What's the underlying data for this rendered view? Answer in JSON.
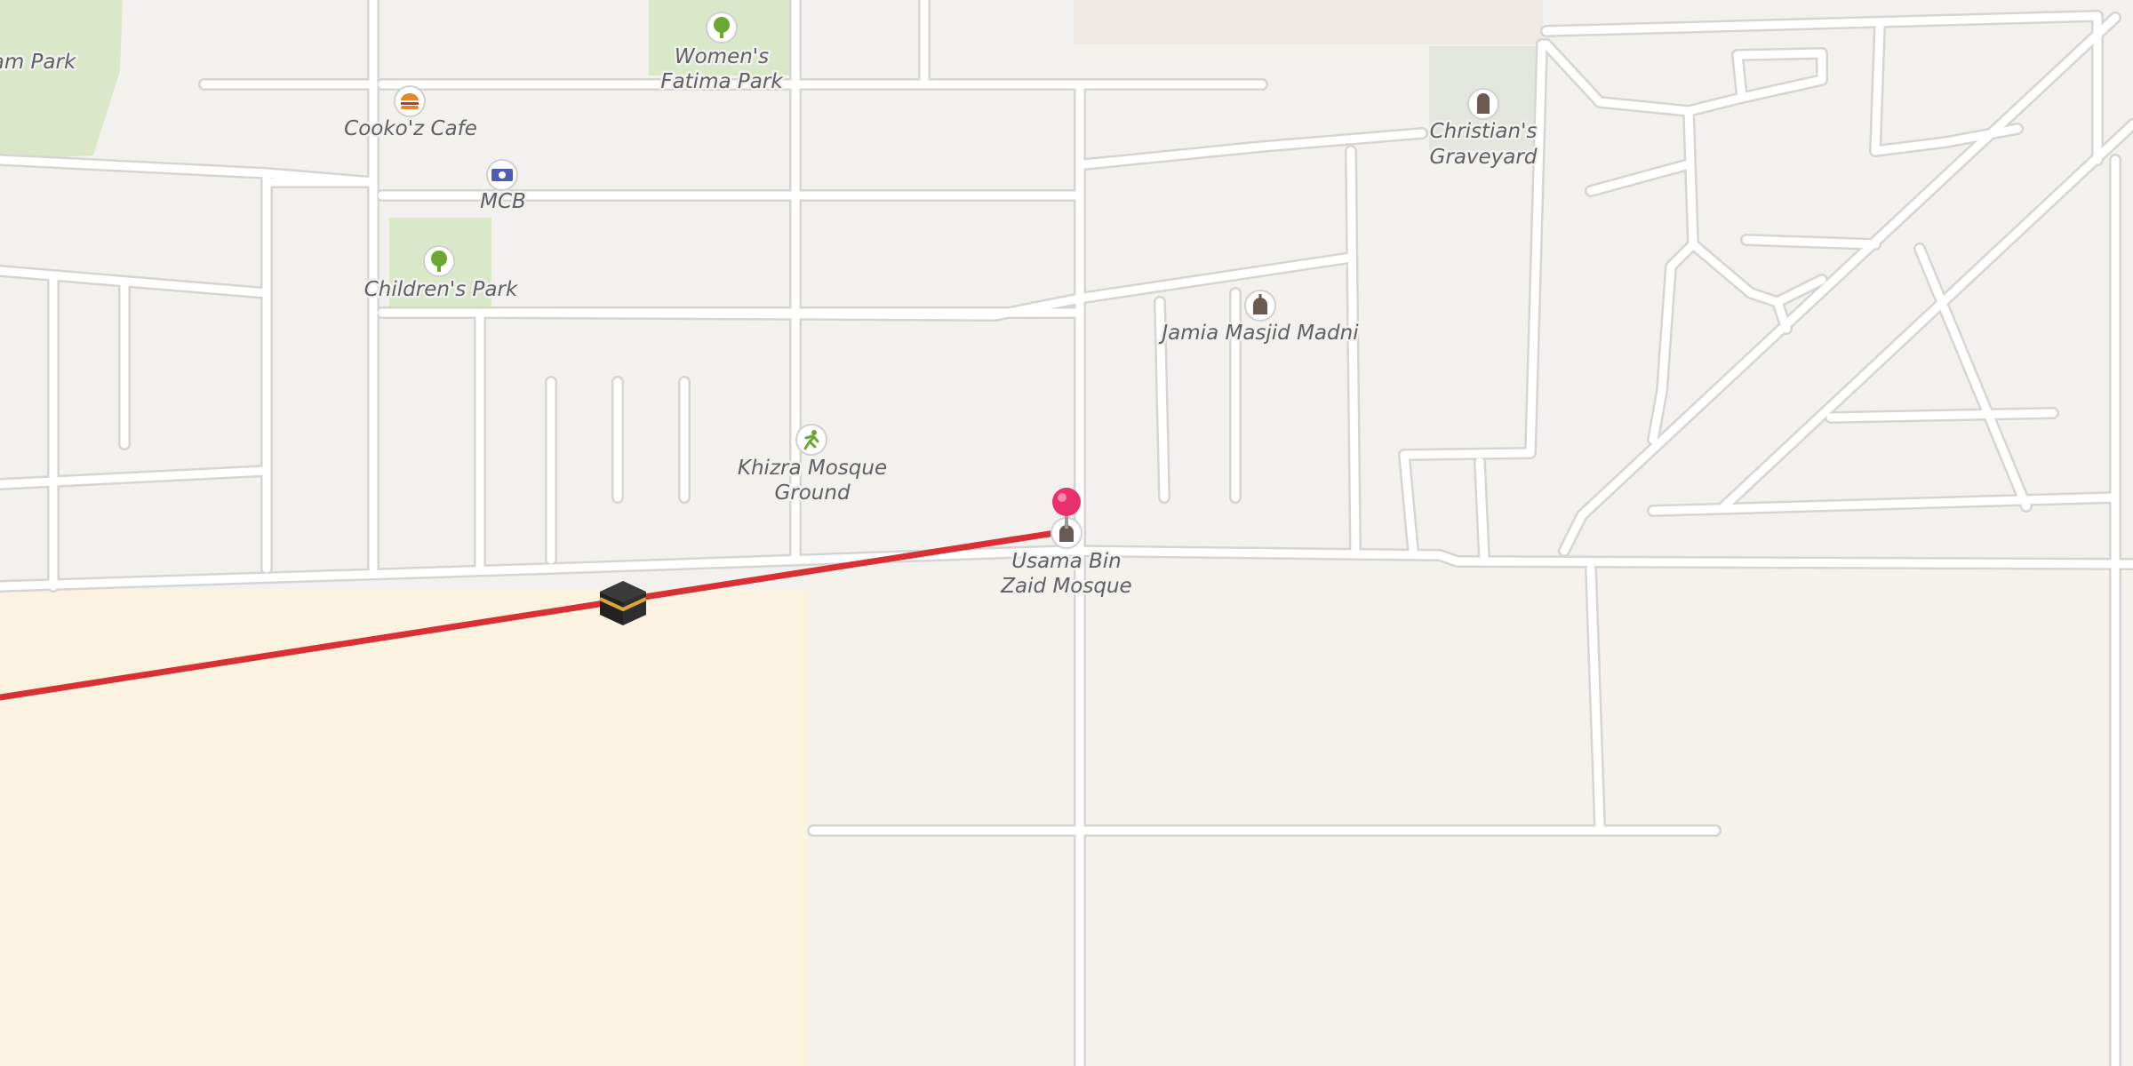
{
  "map": {
    "labels": {
      "park_partial": "am Park",
      "cafe": "Cooko'z Cafe",
      "bank": "MCB",
      "childrens_park": "Children's Park",
      "womens_park_line1": "Women's",
      "womens_park_line2": "Fatima Park",
      "graveyard_line1": "Christian's",
      "graveyard_line2": "Graveyard",
      "jamia_masjid": "Jamia Masjid Madni",
      "ground_line1": "Khizra Mosque",
      "ground_line2": "Ground",
      "usama_line1": "Usama Bin",
      "usama_line2": "Zaid Mosque"
    },
    "icons": {
      "park": "tree-icon",
      "cafe": "burger-icon",
      "bank": "banknote-icon",
      "mosque": "mosque-icon",
      "sports": "running-person-icon",
      "cemetery": "gravestone-icon",
      "pin": "location-pin-icon",
      "qibla": "kaaba-icon"
    },
    "colors": {
      "land": "#f3f1ee",
      "road": "#ffffff",
      "road_casing": "#d7d5d2",
      "park": "#d9e8c9",
      "graveyard": "#e3e6df",
      "sand": "#fbf3e0",
      "qibla_line": "#d93036",
      "pin": "#ea2f6d",
      "label": "#5f5f66",
      "icon_park": "#6aa832",
      "icon_poi": "#6b5a51"
    }
  }
}
